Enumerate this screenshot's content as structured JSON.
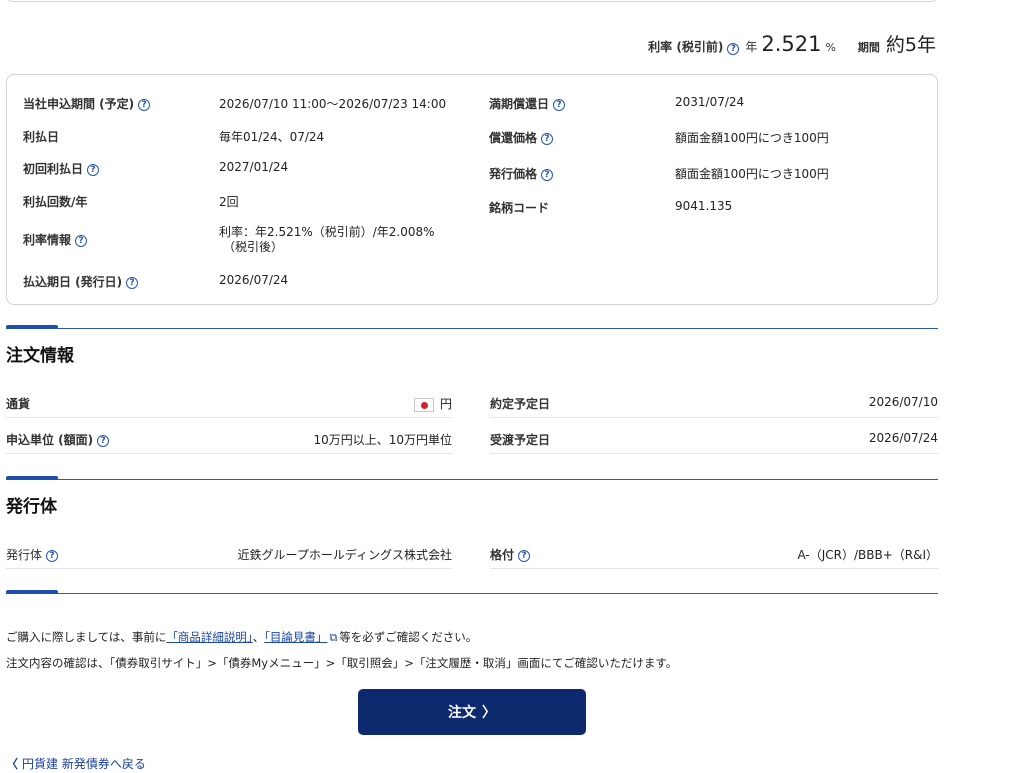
{
  "summary": {
    "rate_label": "利率 (税引前)",
    "rate_prefix": "年",
    "rate_value": "2.521",
    "rate_unit": "%",
    "term_label": "期間",
    "term_value": "約5年"
  },
  "details": {
    "left": [
      {
        "label": "当社申込期間 (予定)",
        "value": "2026/07/10 11:00〜2026/07/23 14:00"
      },
      {
        "label": "利払日",
        "value": "毎年01/24、07/24"
      },
      {
        "label": "初回利払日",
        "value": "2027/01/24"
      },
      {
        "label": "利払回数/年",
        "value": "2回"
      },
      {
        "label": "利率情報",
        "value": "利率：年2.521%（税引前）/年2.008%",
        "value2": "（税引後）"
      },
      {
        "label": "払込期日 (発行日)",
        "value": "2026/07/24"
      }
    ],
    "right": [
      {
        "label": "満期償還日",
        "value": "2031/07/24"
      },
      {
        "label": "償還価格",
        "value": "額面金額100円につき100円"
      },
      {
        "label": "発行価格",
        "value": "額面金額100円につき100円"
      },
      {
        "label": "銘柄コード",
        "value": "9041.135"
      }
    ]
  },
  "order_info": {
    "title": "注文情報",
    "currency_label": "通貨",
    "currency_value": "円",
    "unit_label": "申込単位 (額面)",
    "unit_value": "10万円以上、10万円単位",
    "contract_label": "約定予定日",
    "contract_value": "2026/07/10",
    "delivery_label": "受渡予定日",
    "delivery_value": "2026/07/24"
  },
  "issuer": {
    "title": "発行体",
    "issuer_label": "発行体",
    "issuer_value": "近鉄グループホールディングス株式会社",
    "rating_label": "格付",
    "rating_value": "A-（JCR）/BBB+（R&I）"
  },
  "notes": {
    "line1_prefix": "ご購入に際しましては、事前に",
    "link1": "「商品詳細説明」",
    "sep": "、",
    "link2": "「目論見書」",
    "line1_suffix": "等を必ずご確認ください。",
    "line2": "注文内容の確認は、「債券取引サイト」>「債券Myメニュー」>「取引照会」>「注文履歴・取消」画面にてご確認いただけます。"
  },
  "actions": {
    "order_button": "注文",
    "back_link": "円貨建 新発債券へ戻る"
  },
  "colors": {
    "primary": "#0e2a6e",
    "accent": "#1e4fb0",
    "link": "#1a47a8"
  }
}
